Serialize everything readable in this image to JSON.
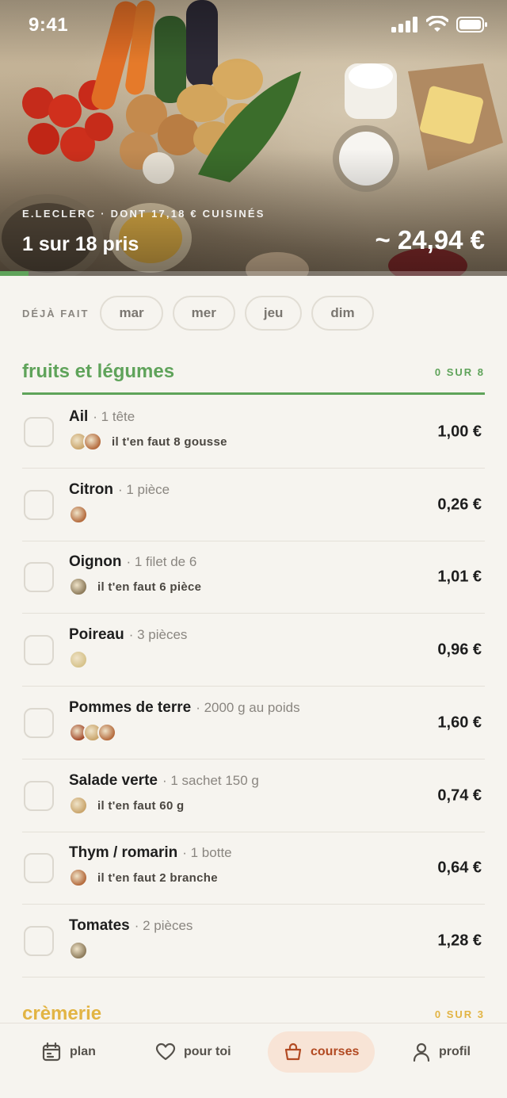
{
  "status_bar": {
    "time": "9:41"
  },
  "hero": {
    "store_line": "E.LECLERC · DONT 17,18 € CUISINÉS",
    "progress_text": "1 sur 18 pris",
    "progress_fraction": 0.0556,
    "total": "~ 24,94 €"
  },
  "days": {
    "label": "DÉJÀ FAIT",
    "chips": [
      "mar",
      "mer",
      "jeu",
      "dim"
    ]
  },
  "sections": [
    {
      "title": "fruits et légumes",
      "count": "0 SUR 8",
      "color": "#5fa35a",
      "items": [
        {
          "name": "Ail",
          "qty": "· 1 tête",
          "need": "il t'en faut 8 gousse",
          "price": "1,00 €",
          "thumbs": 2
        },
        {
          "name": "Citron",
          "qty": "· 1 pièce",
          "need": "",
          "price": "0,26 €",
          "thumbs": 1
        },
        {
          "name": "Oignon",
          "qty": "· 1 filet de 6",
          "need": "il t'en faut 6 pièce",
          "price": "1,01 €",
          "thumbs": 1
        },
        {
          "name": "Poireau",
          "qty": "· 3 pièces",
          "need": "",
          "price": "0,96 €",
          "thumbs": 1
        },
        {
          "name": "Pommes de terre",
          "qty": "· 2000 g au poids",
          "need": "",
          "price": "1,60 €",
          "thumbs": 3
        },
        {
          "name": "Salade verte",
          "qty": "· 1 sachet 150 g",
          "need": "il t'en faut 60 g",
          "price": "0,74 €",
          "thumbs": 1
        },
        {
          "name": "Thym / romarin",
          "qty": "· 1 botte",
          "need": "il t'en faut 2 branche",
          "price": "0,64 €",
          "thumbs": 1
        },
        {
          "name": "Tomates",
          "qty": "· 2 pièces",
          "need": "",
          "price": "1,28 €",
          "thumbs": 1
        }
      ]
    },
    {
      "title": "crèmerie",
      "count": "0 SUR 3",
      "color": "#e2b444"
    }
  ],
  "nav": {
    "plan": "plan",
    "pour_toi": "pour toi",
    "courses": "courses",
    "profil": "profil"
  },
  "colors": {
    "green": "#5fa35a",
    "yellow": "#e2b444",
    "active_nav_bg": "#f8e4d6",
    "active_nav_text": "#b24a22"
  }
}
